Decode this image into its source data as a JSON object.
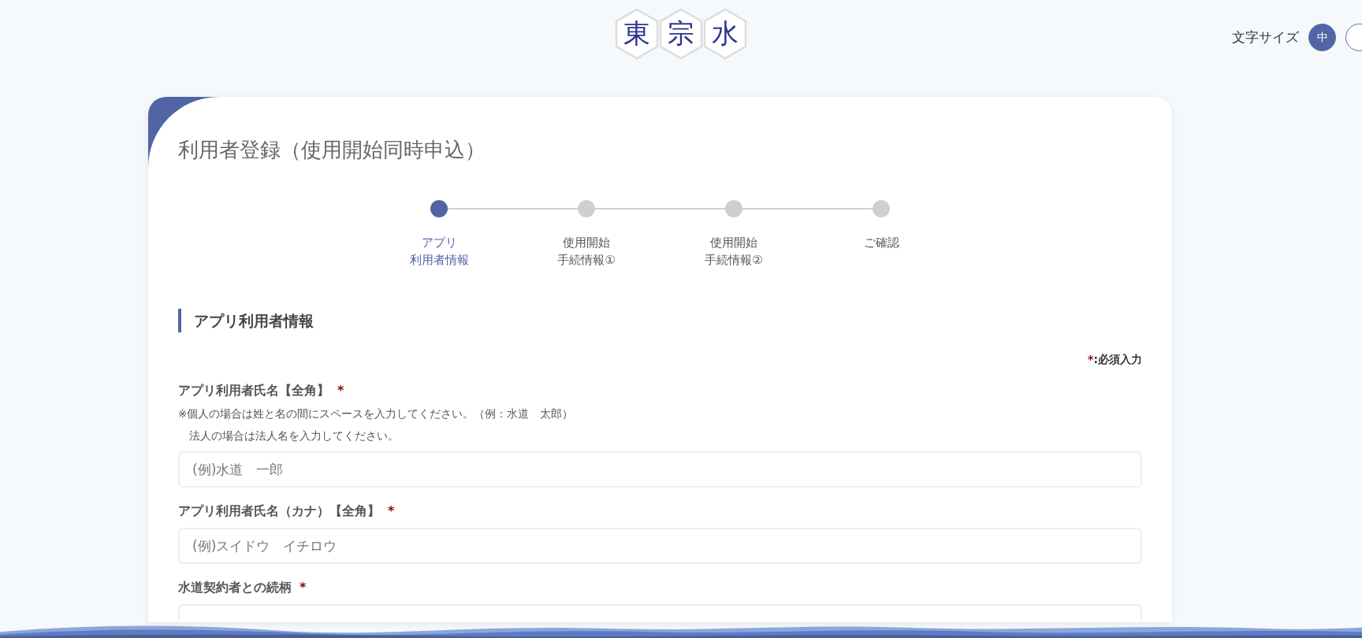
{
  "header": {
    "logo": [
      "東",
      "宗",
      "水"
    ],
    "font_size": {
      "label": "文字サイズ",
      "options": [
        {
          "label": "中",
          "selected": true
        },
        {
          "selected": false
        }
      ]
    }
  },
  "card": {
    "title": "利用者登録（使用開始同時申込）",
    "steps": [
      {
        "lines": [
          "アプリ",
          "利用者情報"
        ],
        "selected": true
      },
      {
        "lines": [
          "使用開始",
          "手続情報①"
        ],
        "selected": false
      },
      {
        "lines": [
          "使用開始",
          "手続情報②"
        ],
        "selected": false
      },
      {
        "lines": [
          "ご確認"
        ],
        "selected": false
      }
    ],
    "section": "アプリ利用者情報",
    "required_note": {
      "mark": "*",
      "text": ":必須入力"
    },
    "fields": [
      {
        "kind": "text",
        "label": "アプリ利用者氏名【全角】",
        "required_mark": "*",
        "notes": [
          "※個人の場合は姓と名の間にスペースを入力してください。（例：水道　太郎）",
          "　法人の場合は法人名を入力してください。"
        ],
        "placeholder": "(例)水道　一郎"
      },
      {
        "kind": "text",
        "label": "アプリ利用者氏名（カナ）【全角】",
        "required_mark": "*",
        "placeholder": "(例)スイドウ　イチロウ"
      },
      {
        "kind": "select",
        "label": "水道契約者との続柄",
        "required_mark": "*"
      }
    ]
  }
}
